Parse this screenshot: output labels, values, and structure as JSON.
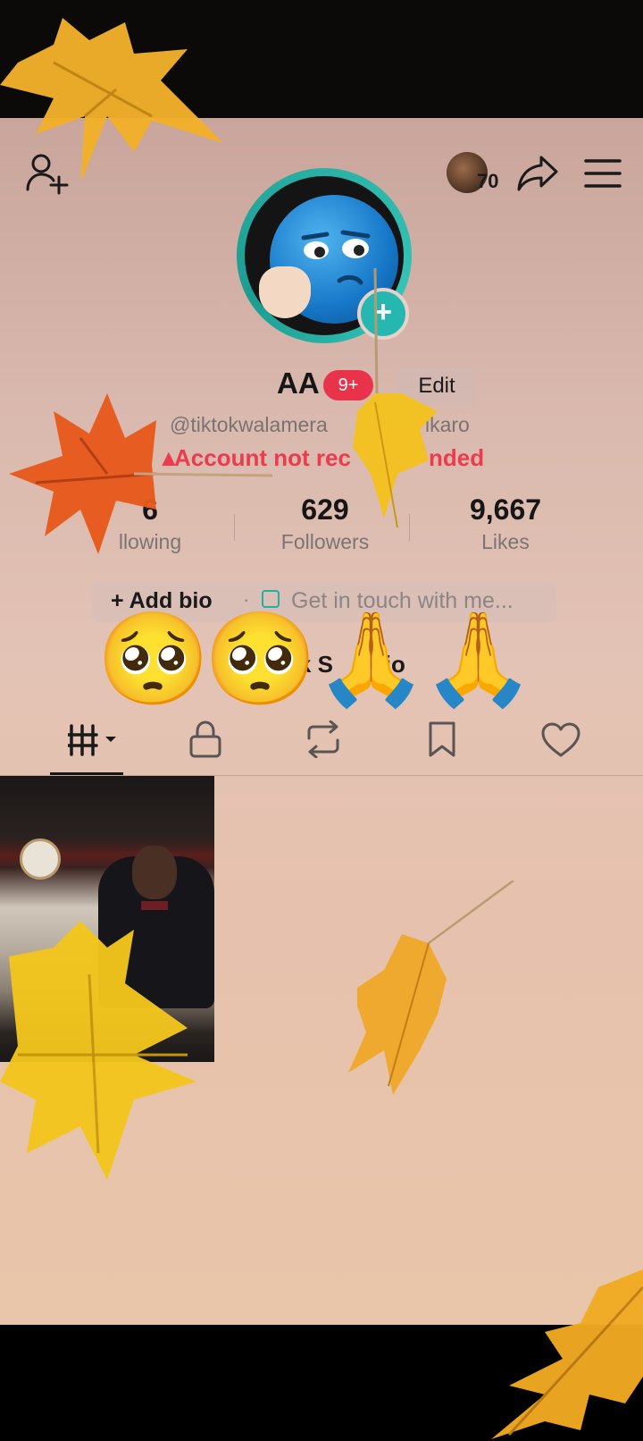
{
  "header": {
    "visitor_count": "70"
  },
  "profile": {
    "username": "AA",
    "notification_badge": "9+",
    "edit_label": "Edit",
    "handle": "@tiktokwalamera",
    "handle_suffix": "ikaro",
    "warning_prefix": "Account not rec",
    "warning_suffix": "nded"
  },
  "stats": [
    {
      "value": "6",
      "label": "llowing"
    },
    {
      "value": "629",
      "label": "Followers"
    },
    {
      "value": "9,667",
      "label": "Likes"
    }
  ],
  "bio": {
    "add_bio_label": "+ Add bio",
    "separator": "·",
    "contact_label": "Get in touch with me..."
  },
  "studio": {
    "prefix": "ok S",
    "suffix": "dio"
  },
  "tabs": [
    {
      "icon": "grid-icon",
      "active": true
    },
    {
      "icon": "lock-icon",
      "active": false
    },
    {
      "icon": "repost-icon",
      "active": false
    },
    {
      "icon": "bookmark-icon",
      "active": false
    },
    {
      "icon": "heart-icon",
      "active": false
    }
  ],
  "overlay_emojis": [
    "🥺",
    "🥺",
    "🙏",
    "🙏"
  ],
  "colors": {
    "accent_red": "#ec3b4f",
    "ring_teal": "#2ab0a5"
  }
}
